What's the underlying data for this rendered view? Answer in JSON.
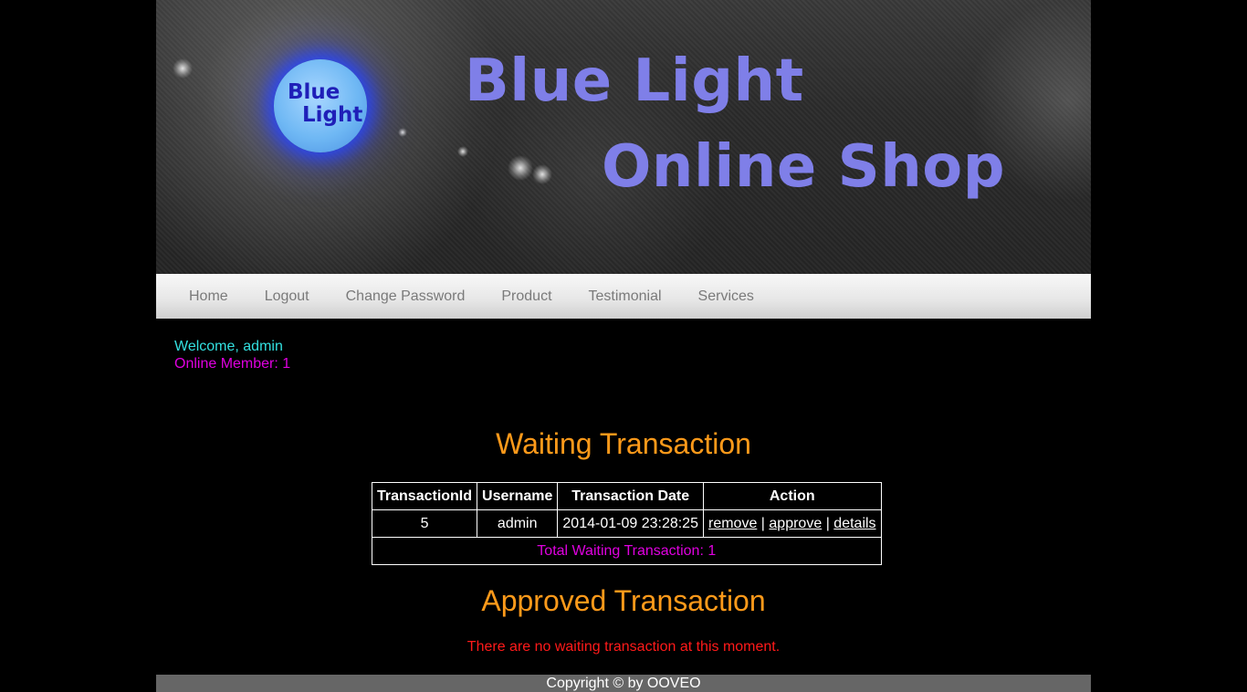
{
  "banner": {
    "logo_line1": "Blue",
    "logo_line2": "Light",
    "title_line1": "Blue Light",
    "title_line2": "Online Shop"
  },
  "nav": {
    "items": [
      {
        "label": "Home"
      },
      {
        "label": "Logout"
      },
      {
        "label": "Change Password"
      },
      {
        "label": "Product"
      },
      {
        "label": "Testimonial"
      },
      {
        "label": "Services"
      }
    ]
  },
  "welcome": {
    "greeting": "Welcome, admin",
    "online": "Online Member: 1"
  },
  "waiting": {
    "heading": "Waiting Transaction",
    "columns": [
      "TransactionId",
      "Username",
      "Transaction Date",
      "Action"
    ],
    "rows": [
      {
        "id": "5",
        "username": "admin",
        "date": "2014-01-09 23:28:25",
        "actions": [
          "remove",
          "approve",
          "details"
        ]
      }
    ],
    "action_separator": "|",
    "total": "Total Waiting Transaction: 1"
  },
  "approved": {
    "heading": "Approved Transaction",
    "empty_message": "There are no waiting transaction at this moment."
  },
  "footer": {
    "text": "Copyright © by OOVEO"
  },
  "colors": {
    "title": "#7f7fe8",
    "heading": "#ff9a1a",
    "welcome": "#33e0e0",
    "online": "#e000e0",
    "error": "#ff1a1a",
    "footer_bg": "#666666"
  }
}
